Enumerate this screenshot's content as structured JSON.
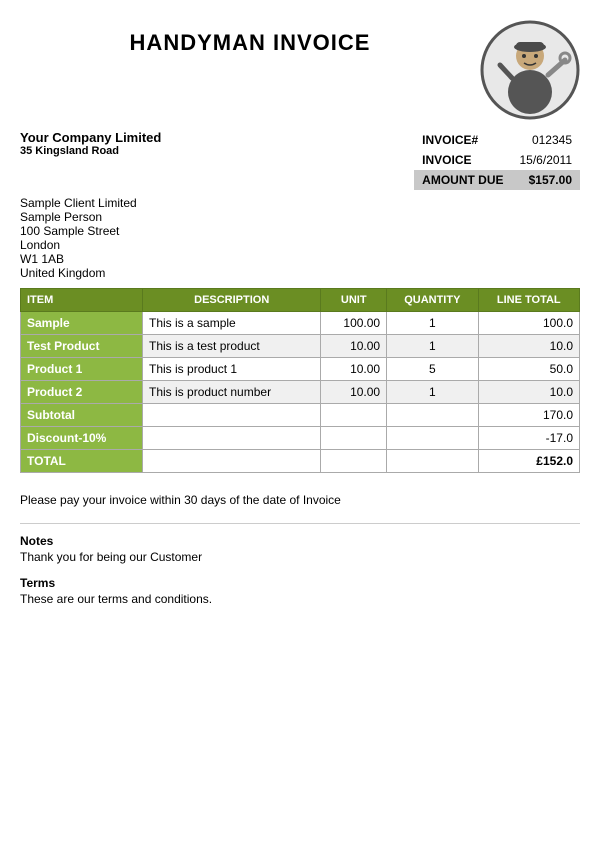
{
  "header": {
    "title": "HANDYMAN INVOICE"
  },
  "company": {
    "name_line1": "Your Company",
    "name_line2": "Limited",
    "address1": "35 Kingsland Road",
    "address2": ""
  },
  "client": {
    "name": "Sample Client Limited",
    "contact": "Sample Person",
    "address1": "100 Sample Street",
    "city": "London",
    "postcode": "W1 1AB",
    "country": "United Kingdom"
  },
  "invoice": {
    "number_label": "INVOICE#",
    "number_value": "012345",
    "date_label": "INVOICE",
    "date_value": "15/6/2011",
    "amount_label": "AMOUNT DUE",
    "amount_value": "$157.00"
  },
  "table": {
    "headers": [
      "ITEM",
      "DESCRIPTION",
      "UNIT",
      "QUANTITY",
      "LINE TOTAL"
    ],
    "rows": [
      {
        "item": "Sample",
        "description": "This is a sample",
        "unit": "100.00",
        "quantity": "1",
        "line_total": "100.0"
      },
      {
        "item": "Test Product",
        "description": "This is a test product",
        "unit": "10.00",
        "quantity": "1",
        "line_total": "10.0"
      },
      {
        "item": "Product 1",
        "description": "This is product 1",
        "unit": "10.00",
        "quantity": "5",
        "line_total": "50.0"
      },
      {
        "item": "Product 2",
        "description": "This is product number",
        "unit": "10.00",
        "quantity": "1",
        "line_total": "10.0"
      }
    ],
    "subtotal_label": "Subtotal",
    "subtotal_value": "170.0",
    "discount_label": "Discount-10%",
    "discount_value": "-17.0",
    "total_label": "TOTAL",
    "total_value": "£152.0"
  },
  "payment": {
    "text": "Please pay your invoice within 30 days of the date of Invoice"
  },
  "notes": {
    "title": "Notes",
    "text": "Thank you for being our Customer"
  },
  "terms": {
    "title": "Terms",
    "text": "These are our terms and conditions."
  }
}
